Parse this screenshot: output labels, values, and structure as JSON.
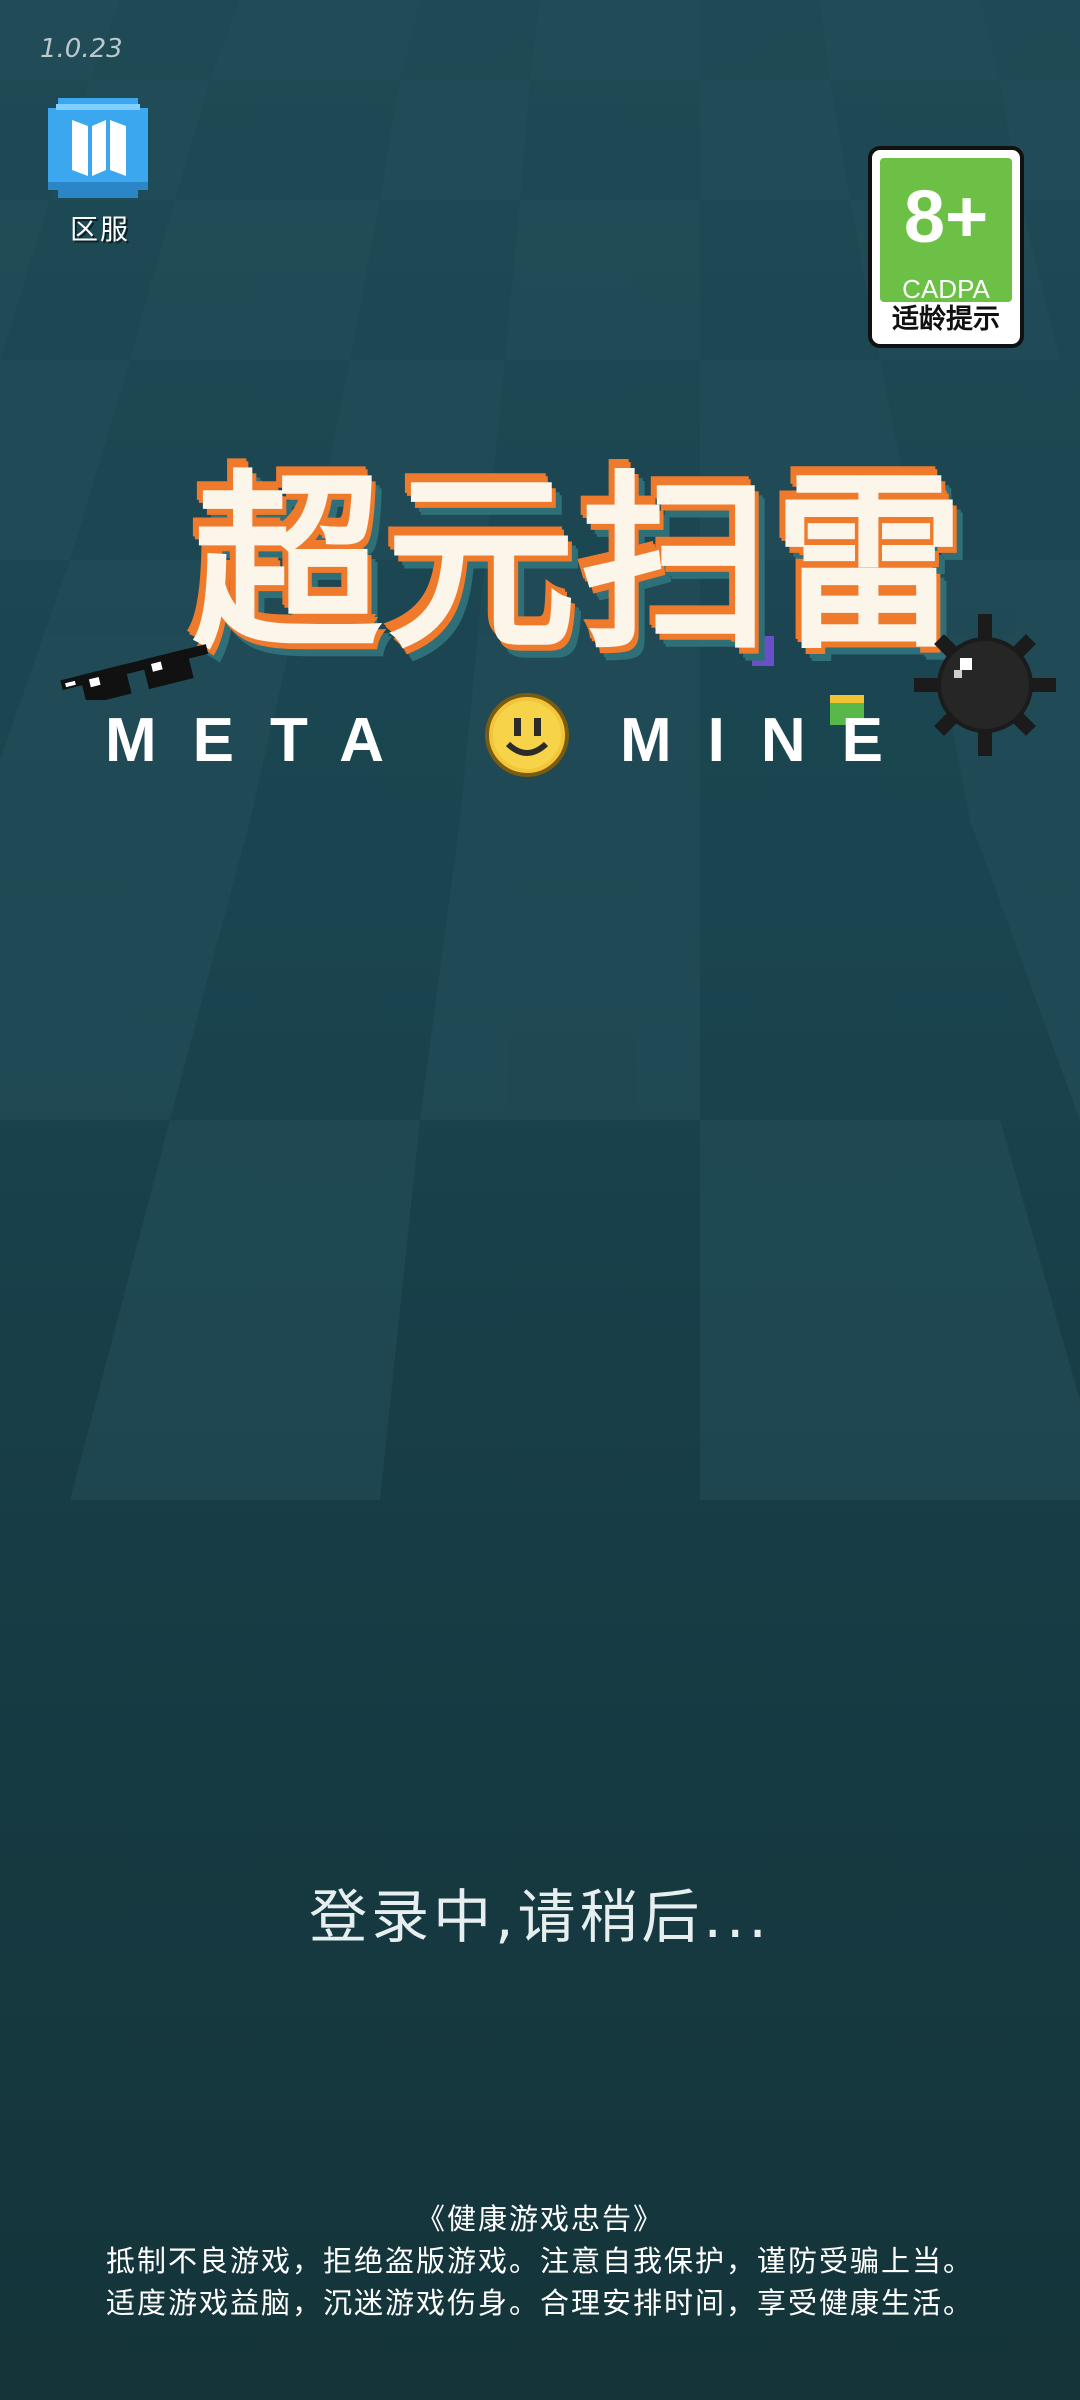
{
  "app": {
    "version": "1.0.23"
  },
  "server": {
    "label": "区服",
    "icon": "map-icon"
  },
  "age_rating": {
    "value": "8+",
    "org": "CADPA",
    "tip": "适龄提示",
    "color": "#6cc046"
  },
  "logo": {
    "title": "超元扫雷",
    "sub_left": "META",
    "sub_right": "MINE",
    "accent": "#f07a2c"
  },
  "status": {
    "text": "登录中,请稍后..."
  },
  "health_advice": {
    "title": "《健康游戏忠告》",
    "line1": "抵制不良游戏，拒绝盗版游戏。注意自我保护，谨防受骗上当。",
    "line2": "适度游戏益脑，沉迷游戏伤身。合理安排时间，享受健康生活。"
  }
}
